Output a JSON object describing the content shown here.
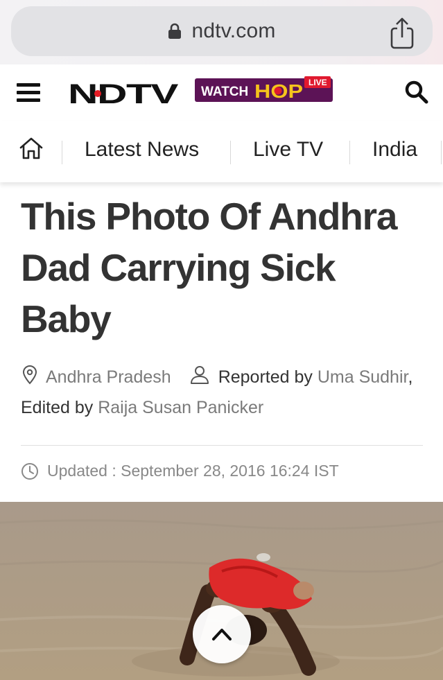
{
  "browser": {
    "url": "ndtv.com",
    "icons": {
      "lock": "lock-icon",
      "share": "share-icon"
    }
  },
  "header": {
    "logo_text": "NDTV",
    "promo": {
      "watch": "WATCH",
      "brand": "HOP",
      "badge": "LIVE"
    },
    "icons": {
      "menu": "hamburger-menu-icon",
      "search": "search-icon"
    },
    "colors": {
      "logo": "#111111",
      "logo_dot": "#e51b24",
      "promo_bg": "#5c1356",
      "promo_brand": "#f6c31c",
      "badge_bg": "#e0192f"
    }
  },
  "nav": {
    "home_icon": "home-icon",
    "items": [
      {
        "label": "Latest News"
      },
      {
        "label": "Live TV"
      },
      {
        "label": "India"
      }
    ]
  },
  "article": {
    "headline": "This Photo Of Andhra Dad Carrying Sick Baby",
    "location": "Andhra Pradesh",
    "reported_by_label": "Reported by",
    "reporter": "Uma Sudhir",
    "edited_by_label": "Edited by",
    "editor": "Raija Susan Panicker",
    "updated": "Updated : September 28, 2016 16:24 IST",
    "meta_icons": {
      "location": "map-pin-icon",
      "author": "person-icon",
      "time": "clock-icon"
    },
    "image_alt": "Father wading through floodwater holding a baby wrapped in red cloth above his head"
  },
  "controls": {
    "scroll_top_icon": "chevron-up-icon"
  }
}
